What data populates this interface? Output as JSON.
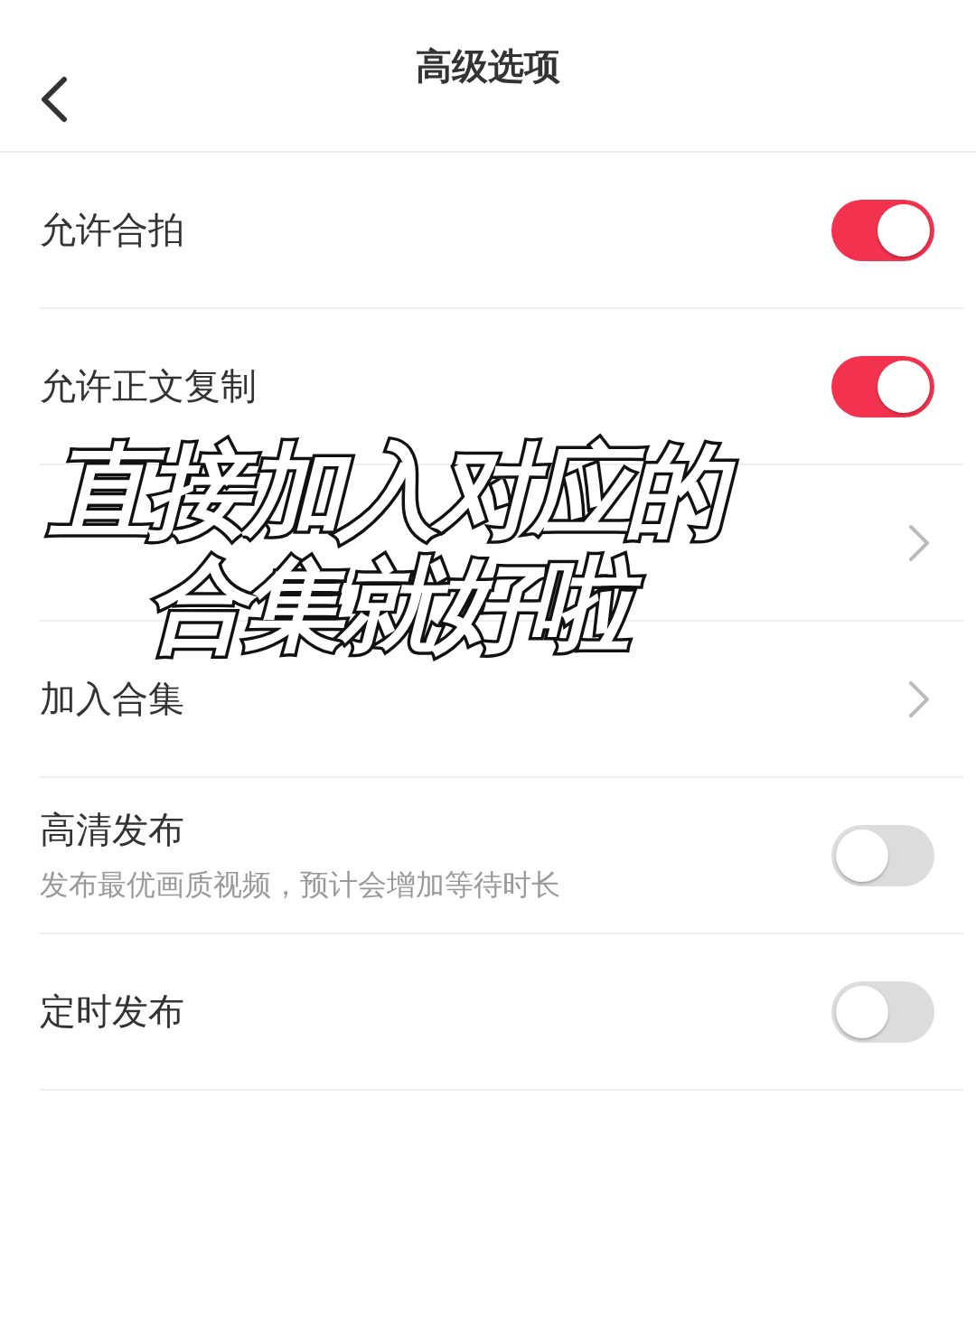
{
  "header": {
    "title": "高级选项"
  },
  "rows": [
    {
      "kind": "toggle",
      "label": "允许合拍",
      "on": true
    },
    {
      "kind": "toggle",
      "label": "允许正文复制",
      "on": true
    },
    {
      "kind": "link"
    },
    {
      "kind": "link",
      "label": "加入合集"
    },
    {
      "kind": "toggle",
      "label": "高清发布",
      "subtitle": "发布最优画质视频，预计会增加等待时长",
      "on": false
    },
    {
      "kind": "toggle",
      "label": "定时发布",
      "on": false
    }
  ],
  "overlay": {
    "lines": [
      "直接加入对应的",
      "合集就好啦"
    ]
  }
}
